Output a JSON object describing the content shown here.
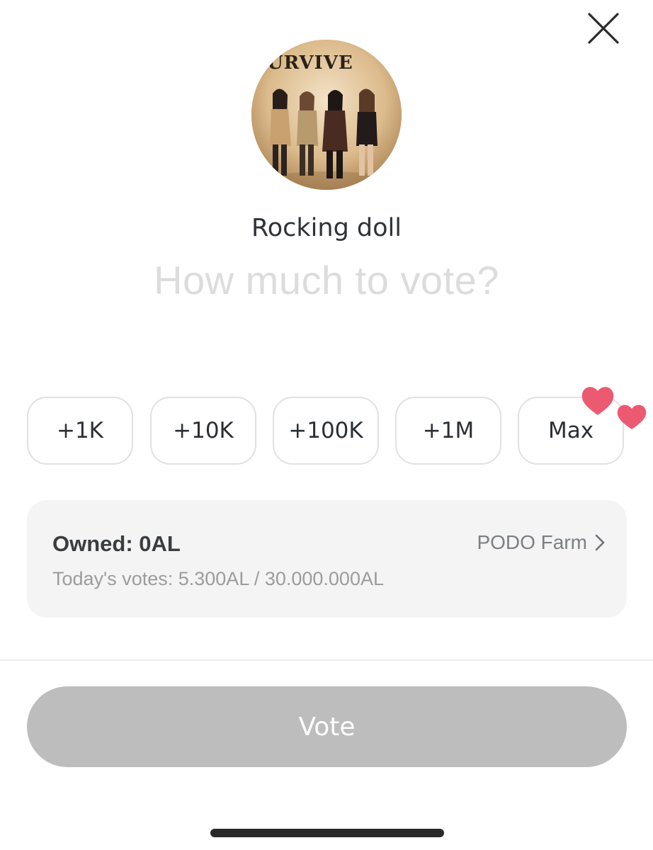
{
  "dialog": {
    "close_icon": "close-icon",
    "target": {
      "avatar_caption": "URVIVE",
      "name": "Rocking doll"
    },
    "prompt": "How much to vote?",
    "amount_options": [
      {
        "label": "+1K"
      },
      {
        "label": "+10K"
      },
      {
        "label": "+100K"
      },
      {
        "label": "+1M"
      },
      {
        "label": "Max"
      }
    ],
    "balance_card": {
      "owned": "Owned: 0AL",
      "today_votes": "Today's votes: 5.300AL / 30.000.000AL",
      "farm_link": "PODO Farm"
    },
    "vote_button": "Vote"
  },
  "colors": {
    "accent_heart": "#ec5a72",
    "vote_button_disabled": "#bdbdbd",
    "card_background": "#f4f4f4"
  }
}
